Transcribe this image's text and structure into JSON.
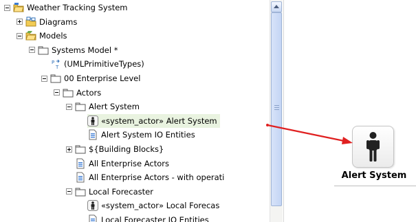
{
  "tree": {
    "items": [
      {
        "label": "Weather Tracking System",
        "indent": 0,
        "expander": "minus",
        "icon": "project-folder-icon"
      },
      {
        "label": "Diagrams",
        "indent": 1,
        "expander": "plus",
        "icon": "diagrams-folder-icon"
      },
      {
        "label": "Models",
        "indent": 1,
        "expander": "minus",
        "icon": "models-folder-icon"
      },
      {
        "label": "Systems Model *",
        "indent": 2,
        "expander": "minus",
        "icon": "package-icon"
      },
      {
        "label": "(UMLPrimitiveTypes)",
        "indent": 3,
        "expander": "none",
        "icon": "primitive-types-icon"
      },
      {
        "label": "00 Enterprise Level",
        "indent": 3,
        "expander": "minus",
        "icon": "package-icon"
      },
      {
        "label": "Actors",
        "indent": 4,
        "expander": "minus",
        "icon": "package-icon"
      },
      {
        "label": "Alert System",
        "indent": 5,
        "expander": "minus",
        "icon": "package-icon"
      },
      {
        "label": "«system_actor» Alert System",
        "indent": 6,
        "expander": "none",
        "icon": "actor-icon",
        "selected": true
      },
      {
        "label": "Alert System IO Entities",
        "indent": 6,
        "expander": "none",
        "icon": "diagram-doc-icon"
      },
      {
        "label": "${Building Blocks}",
        "indent": 5,
        "expander": "plus",
        "icon": "package-icon"
      },
      {
        "label": "All Enterprise Actors",
        "indent": 5,
        "expander": "none",
        "icon": "diagram-doc-icon"
      },
      {
        "label": "All Enterprise Actors - with operati",
        "indent": 5,
        "expander": "none",
        "icon": "diagram-doc-icon"
      },
      {
        "label": "Local Forecaster",
        "indent": 5,
        "expander": "minus",
        "icon": "package-icon"
      },
      {
        "label": "«system_actor» Local Forecas",
        "indent": 6,
        "expander": "none",
        "icon": "actor-icon"
      },
      {
        "label": "Local Forecaster IO Entities",
        "indent": 6,
        "expander": "none",
        "icon": "diagram-doc-icon"
      }
    ]
  },
  "diagram": {
    "actor_label": "Alert System",
    "actor_icon": "actor-icon",
    "arrow_color": "#e02020"
  },
  "colors": {
    "selection_bg": "#e9f3e0",
    "scrollbar_thumb": "#c4d5f4",
    "folder_yellow": "#f2cc55"
  }
}
